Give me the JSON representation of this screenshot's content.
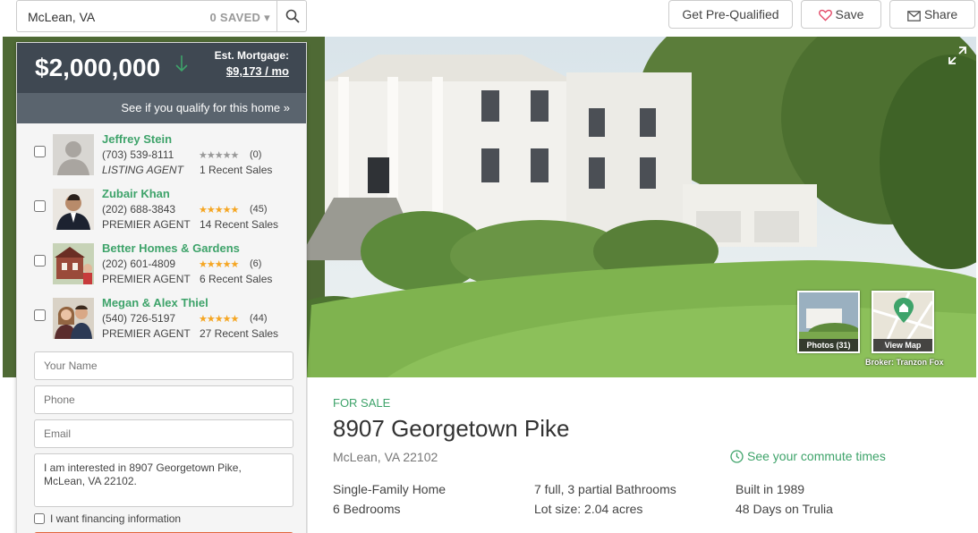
{
  "search": {
    "location": "McLean, VA",
    "saved_label": "0 SAVED ▾"
  },
  "header": {
    "prequal_label": "Get Pre-Qualified",
    "save_label": "Save",
    "share_label": "Share"
  },
  "listing": {
    "price": "$2,000,000",
    "mortgage_label": "Est. Mortgage:",
    "mortgage_value": "$9,173 / mo",
    "qualify_link": "See if you qualify for this home »",
    "status": "FOR SALE",
    "address": "8907 Georgetown Pike",
    "city": "McLean, VA 22102",
    "commute_link": "See your commute times",
    "facts": [
      "Single-Family Home",
      "6 Bedrooms",
      "7 full, 3 partial Bathrooms",
      "Lot size: 2.04 acres",
      "Built in 1989",
      "48 Days on Trulia"
    ]
  },
  "photo": {
    "photos_label": "Photos (31)",
    "map_label": "View Map",
    "broker": "Broker: Tranzon Fox"
  },
  "agents": [
    {
      "name": "Jeffrey Stein",
      "phone": "(703) 539-8111",
      "role": "LISTING AGENT",
      "rating": 0,
      "count": "(0)",
      "sales": "1 Recent Sales"
    },
    {
      "name": "Zubair Khan",
      "phone": "(202) 688-3843",
      "role": "PREMIER AGENT",
      "rating": 5,
      "count": "(45)",
      "sales": "14 Recent Sales"
    },
    {
      "name": "Better Homes & Gardens",
      "phone": "(202) 601-4809",
      "role": "PREMIER AGENT",
      "rating": 5,
      "count": "(6)",
      "sales": "6 Recent Sales"
    },
    {
      "name": "Megan & Alex Thiel",
      "phone": "(540) 726-5197",
      "role": "PREMIER AGENT",
      "rating": 5,
      "count": "(44)",
      "sales": "27 Recent Sales"
    }
  ],
  "form": {
    "name_placeholder": "Your Name",
    "phone_placeholder": "Phone",
    "email_placeholder": "Email",
    "message": "I am interested in 8907 Georgetown Pike, McLean, VA 22102.",
    "financing_label": "I want financing information"
  },
  "colors": {
    "accent_green": "#3ea36a",
    "price_bg": "#3f4852",
    "star_gold": "#f5a623",
    "star_gray": "#999999",
    "submit_orange": "#e2653b"
  },
  "icons": [
    "search-icon",
    "heart-icon",
    "mail-icon",
    "expand-icon",
    "down-arrow-icon",
    "clock-icon",
    "map-pin-icon"
  ]
}
